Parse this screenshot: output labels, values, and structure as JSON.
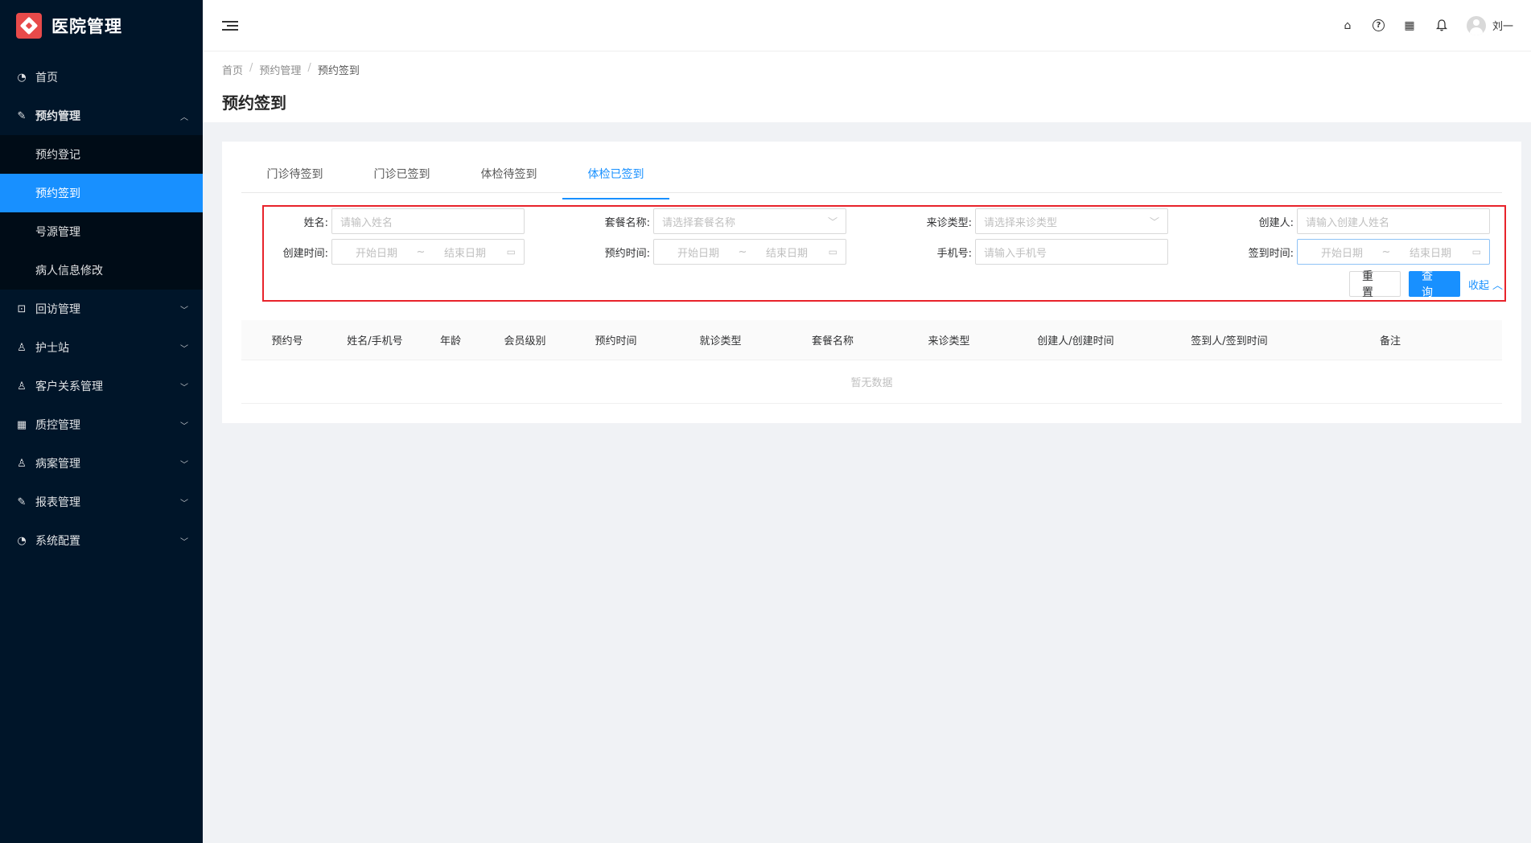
{
  "app": {
    "title": "医院管理"
  },
  "sidebar": {
    "items": [
      {
        "label": "首页",
        "icon": "dashboard-icon",
        "glyph": "◔"
      },
      {
        "label": "预约管理",
        "icon": "edit-icon",
        "glyph": "✎",
        "expanded": true,
        "children": [
          {
            "label": "预约登记"
          },
          {
            "label": "预约签到",
            "active": true
          },
          {
            "label": "号源管理"
          },
          {
            "label": "病人信息修改"
          }
        ]
      },
      {
        "label": "回访管理",
        "icon": "lock-icon",
        "glyph": "⊡"
      },
      {
        "label": "护士站",
        "icon": "user-icon",
        "glyph": "♙"
      },
      {
        "label": "客户关系管理",
        "icon": "user-icon",
        "glyph": "♙"
      },
      {
        "label": "质控管理",
        "icon": "table-icon",
        "glyph": "▦"
      },
      {
        "label": "病案管理",
        "icon": "user-icon",
        "glyph": "♙"
      },
      {
        "label": "报表管理",
        "icon": "edit-icon",
        "glyph": "✎"
      },
      {
        "label": "系统配置",
        "icon": "dashboard-icon",
        "glyph": "◔"
      }
    ]
  },
  "header": {
    "username": "刘一"
  },
  "breadcrumb": [
    "首页",
    "预约管理",
    "预约签到"
  ],
  "page_title": "预约签到",
  "tabs": [
    "门诊待签到",
    "门诊已签到",
    "体检待签到",
    "体检已签到"
  ],
  "active_tab": 3,
  "filters": {
    "name": {
      "label": "姓名:",
      "placeholder": "请输入姓名"
    },
    "package": {
      "label": "套餐名称:",
      "placeholder": "请选择套餐名称"
    },
    "visit_type": {
      "label": "来诊类型:",
      "placeholder": "请选择来诊类型"
    },
    "creator": {
      "label": "创建人:",
      "placeholder": "请输入创建人姓名"
    },
    "create_time": {
      "label": "创建时间:",
      "start": "开始日期",
      "end": "结束日期"
    },
    "appoint_time": {
      "label": "预约时间:",
      "start": "开始日期",
      "end": "结束日期"
    },
    "phone": {
      "label": "手机号:",
      "placeholder": "请输入手机号"
    },
    "checkin_time": {
      "label": "签到时间:",
      "start": "开始日期",
      "end": "结束日期"
    },
    "range_sep": "~"
  },
  "actions": {
    "reset": "重 置",
    "search": "查 询",
    "collapse": "收起"
  },
  "table": {
    "columns": [
      "预约号",
      "姓名/手机号",
      "年龄",
      "会员级别",
      "预约时间",
      "就诊类型",
      "套餐名称",
      "来诊类型",
      "创建人/创建时间",
      "签到人/签到时间",
      "备注"
    ],
    "empty_text": "暂无数据"
  },
  "colors": {
    "sidebar_bg": "#001529",
    "accent": "#1890ff",
    "highlight_border": "#e8232b",
    "logo": "#e84a4a"
  }
}
